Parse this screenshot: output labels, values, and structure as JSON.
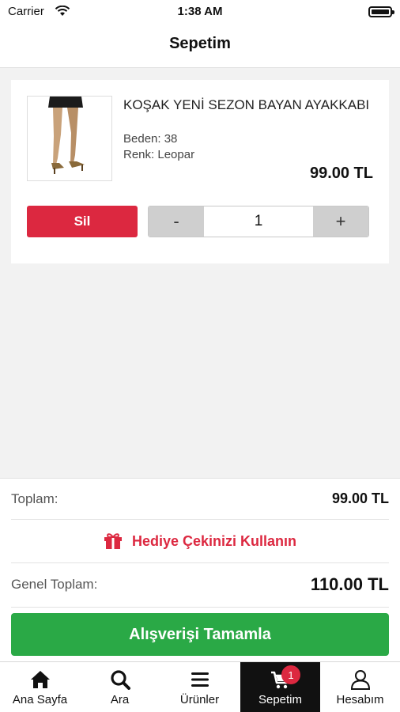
{
  "status_bar": {
    "carrier": "Carrier",
    "time": "1:38 AM"
  },
  "header": {
    "title": "Sepetim"
  },
  "cart": {
    "items": [
      {
        "name": "KOŞAK YENİ SEZON BAYAN AYAKKABI",
        "size": "Beden: 38",
        "color": "Renk: Leopar",
        "price": "99.00 TL",
        "delete_label": "Sil",
        "minus_label": "-",
        "quantity": "1",
        "plus_label": "+"
      }
    ]
  },
  "summary": {
    "subtotal_label": "Toplam:",
    "subtotal_value": "99.00 TL",
    "gift_label": "Hediye Çekinizi Kullanın",
    "grand_total_label": "Genel Toplam:",
    "grand_total_value": "110.00 TL",
    "checkout_label": "Alışverişi Tamamla"
  },
  "tabs": [
    {
      "label": "Ana Sayfa",
      "icon": "home-icon"
    },
    {
      "label": "Ara",
      "icon": "search-icon"
    },
    {
      "label": "Ürünler",
      "icon": "menu-icon"
    },
    {
      "label": "Sepetim",
      "icon": "cart-icon",
      "active": true,
      "badge": "1"
    },
    {
      "label": "Hesabım",
      "icon": "user-icon"
    }
  ],
  "colors": {
    "accent_red": "#dc2840",
    "checkout_green": "#2aa946",
    "active_tab_bg": "#111111"
  }
}
